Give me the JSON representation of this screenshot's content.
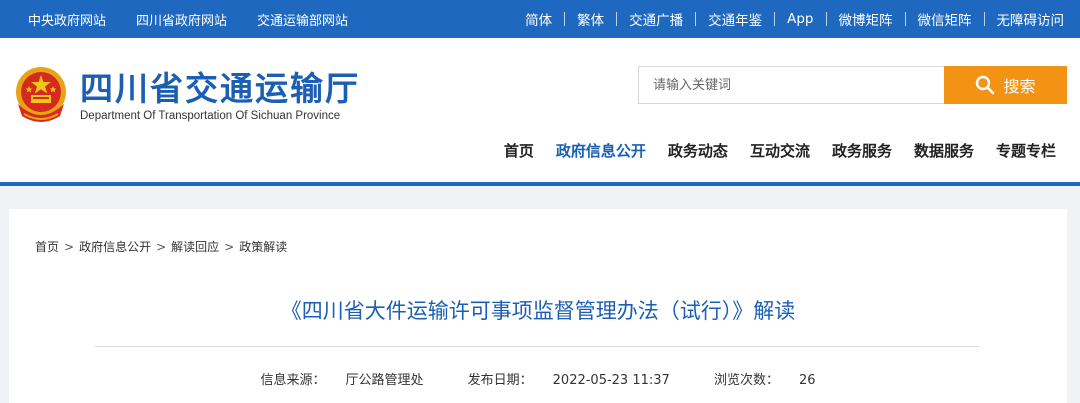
{
  "topbar": {
    "left_links": [
      "中央政府网站",
      "四川省政府网站",
      "交通运输部网站"
    ],
    "right_links": [
      "简体",
      "繁体",
      "交通广播",
      "交通年鉴",
      "App",
      "微博矩阵",
      "微信矩阵",
      "无障碍访问"
    ]
  },
  "header": {
    "site_title": "四川省交通运输厅",
    "site_subtitle": "Department Of Transportation Of Sichuan Province",
    "search": {
      "placeholder": "请输入关键词",
      "button_label": "搜索"
    },
    "nav": [
      "首页",
      "政府信息公开",
      "政务动态",
      "互动交流",
      "政务服务",
      "数据服务",
      "专题专栏"
    ],
    "nav_active_index": 1
  },
  "breadcrumb": [
    "首页",
    "政府信息公开",
    "解读回应",
    "政策解读"
  ],
  "breadcrumb_separator": ">",
  "article": {
    "title": "《四川省大件运输许可事项监督管理办法（试行）》解读",
    "source_label": "信息来源：",
    "source": "厅公路管理处",
    "date_label": "发布日期：",
    "date": "2022-05-23 11:37",
    "views_label": "浏览次数：",
    "views": "26"
  },
  "colors": {
    "primary_blue": "#1e68c0",
    "title_blue": "#1b5fb4",
    "search_orange": "#f39315"
  },
  "icons": {
    "emblem": "national-emblem-icon",
    "search": "search-icon"
  }
}
